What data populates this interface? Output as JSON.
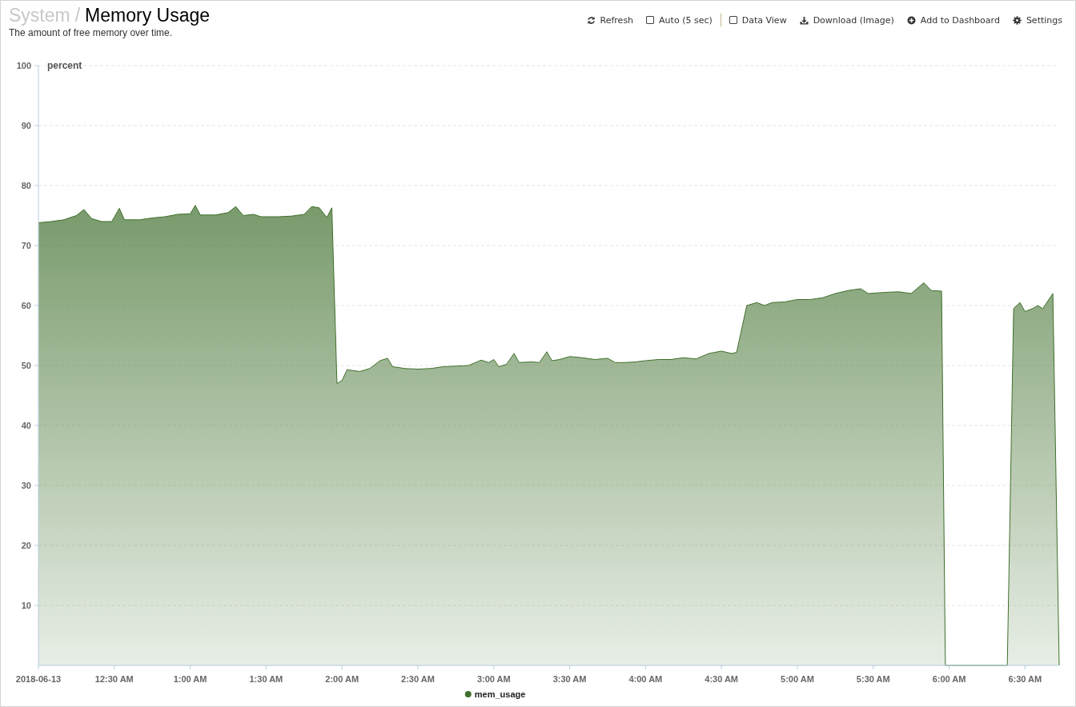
{
  "header": {
    "breadcrumb_parent": "System",
    "separator": "/",
    "title": "Memory Usage",
    "description": "The amount of free memory over time."
  },
  "toolbar": [
    {
      "kind": "refresh",
      "label": "Refresh"
    },
    {
      "kind": "toggle",
      "label": "Auto (5 sec)",
      "checked": false
    },
    {
      "kind": "divider"
    },
    {
      "kind": "toggle",
      "label": "Data View",
      "checked": false
    },
    {
      "kind": "download",
      "label": "Download (Image)"
    },
    {
      "kind": "add",
      "label": "Add to Dashboard"
    },
    {
      "kind": "settings",
      "label": "Settings"
    }
  ],
  "chart": {
    "chart_data": {
      "type": "area",
      "ylabel": "percent",
      "x": [
        0,
        5,
        10,
        15,
        18,
        21,
        25,
        29,
        32,
        34,
        40,
        45,
        50,
        55,
        60,
        62,
        64,
        70,
        75,
        78,
        81,
        85,
        88,
        95,
        100,
        105,
        108,
        111,
        114,
        116,
        118,
        120,
        122,
        127,
        131,
        135,
        138,
        140,
        145,
        150,
        155,
        160,
        165,
        170,
        175,
        178,
        180,
        182,
        185,
        188,
        190,
        195,
        198,
        201,
        203,
        206,
        210,
        215,
        220,
        225,
        228,
        232,
        236,
        240,
        245,
        250,
        255,
        260,
        265,
        270,
        274,
        276,
        280,
        284,
        287,
        290,
        295,
        300,
        305,
        310,
        315,
        320,
        325,
        328,
        335,
        340,
        345,
        350,
        353,
        357,
        358.5,
        383,
        385.5,
        388,
        390,
        393,
        395,
        397,
        401,
        403.5
      ],
      "series": [
        {
          "name": "mem_usage",
          "color": "#3f6f2c",
          "values": [
            73.8,
            74,
            74.3,
            75,
            76,
            74.5,
            74,
            74,
            76.2,
            74.3,
            74.3,
            74.6,
            74.8,
            75.2,
            75.3,
            76.7,
            75.1,
            75.1,
            75.5,
            76.5,
            75,
            75.2,
            74.8,
            74.8,
            74.9,
            75.2,
            76.5,
            76.3,
            74.7,
            76.3,
            47,
            47.5,
            49.3,
            49,
            49.5,
            50.8,
            51.2,
            49.8,
            49.5,
            49.4,
            49.5,
            49.8,
            49.9,
            50,
            50.9,
            50.5,
            51,
            49.8,
            50.2,
            52,
            50.5,
            50.6,
            50.5,
            52.3,
            50.8,
            51,
            51.5,
            51.3,
            51,
            51.2,
            50.5,
            50.5,
            50.6,
            50.8,
            51,
            51,
            51.3,
            51.1,
            52,
            52.4,
            52,
            52.2,
            60,
            60.5,
            60,
            60.5,
            60.6,
            61,
            61,
            61.3,
            62,
            62.5,
            62.8,
            62,
            62.2,
            62.3,
            62,
            63.8,
            62.5,
            62.4,
            0,
            0,
            59.5,
            60.5,
            59,
            59.5,
            60,
            59.5,
            62,
            0
          ]
        }
      ],
      "xlim": [
        0,
        403.5
      ],
      "ylim": [
        0,
        100
      ],
      "xticks": [
        {
          "value": 0,
          "label": "2018-06-13"
        },
        {
          "value": 30,
          "label": "12:30 AM"
        },
        {
          "value": 60,
          "label": "1:00 AM"
        },
        {
          "value": 90,
          "label": "1:30 AM"
        },
        {
          "value": 120,
          "label": "2:00 AM"
        },
        {
          "value": 150,
          "label": "2:30 AM"
        },
        {
          "value": 180,
          "label": "3:00 AM"
        },
        {
          "value": 210,
          "label": "3:30 AM"
        },
        {
          "value": 240,
          "label": "4:00 AM"
        },
        {
          "value": 270,
          "label": "4:30 AM"
        },
        {
          "value": 300,
          "label": "5:00 AM"
        },
        {
          "value": 330,
          "label": "5:30 AM"
        },
        {
          "value": 360,
          "label": "6:00 AM"
        },
        {
          "value": 390,
          "label": "6:30 AM"
        }
      ],
      "yticks": [
        10,
        20,
        30,
        40,
        50,
        60,
        70,
        80,
        90,
        100
      ],
      "grid": true
    }
  }
}
